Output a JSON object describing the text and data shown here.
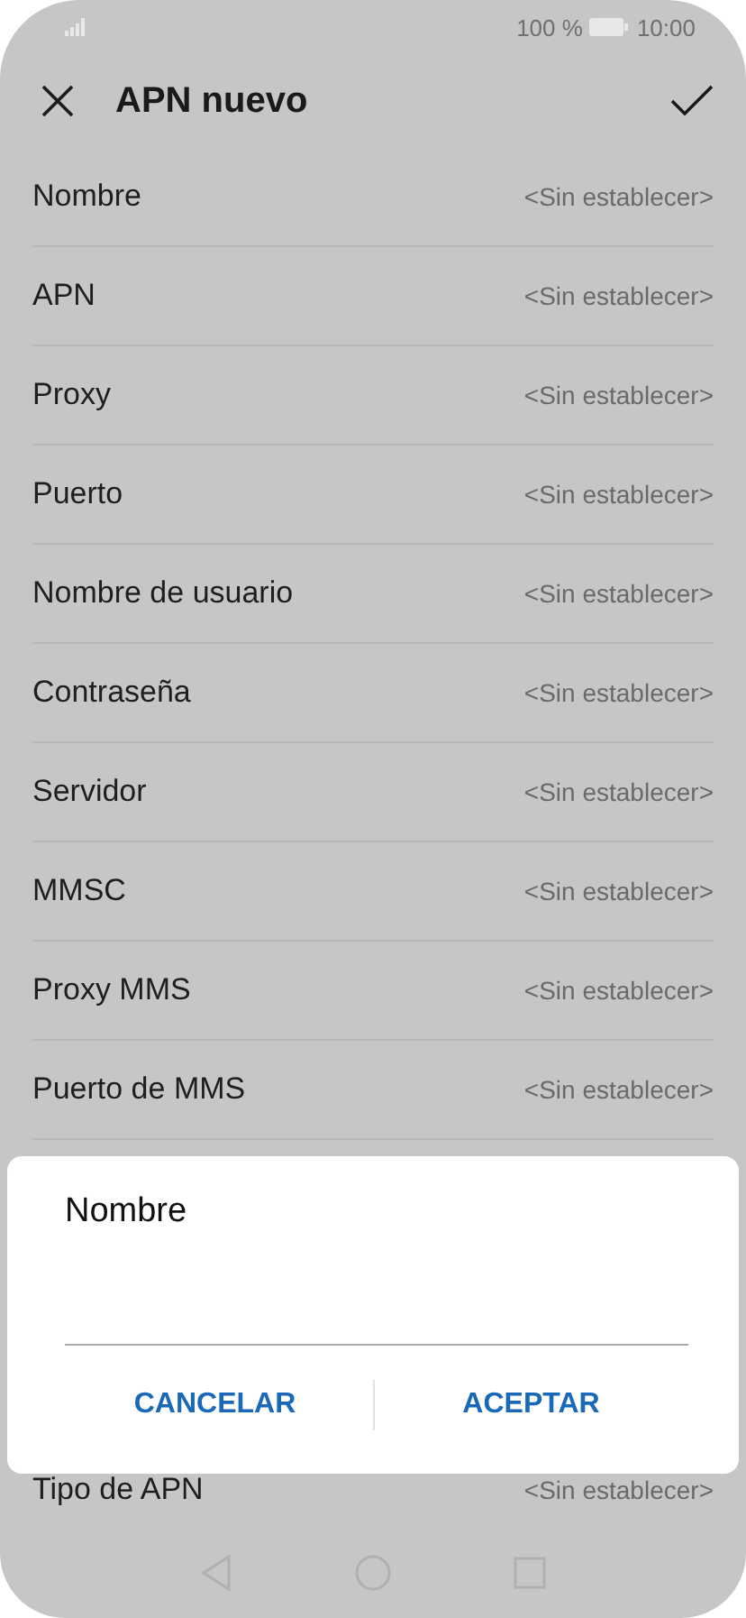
{
  "status_bar": {
    "battery": "100 %",
    "time": "10:00"
  },
  "header": {
    "title": "APN nuevo"
  },
  "rows": [
    {
      "label": "Nombre",
      "value": "<Sin establecer>"
    },
    {
      "label": "APN",
      "value": "<Sin establecer>"
    },
    {
      "label": "Proxy",
      "value": "<Sin establecer>"
    },
    {
      "label": "Puerto",
      "value": "<Sin establecer>"
    },
    {
      "label": "Nombre de usuario",
      "value": "<Sin establecer>"
    },
    {
      "label": "Contraseña",
      "value": "<Sin establecer>"
    },
    {
      "label": "Servidor",
      "value": "<Sin establecer>"
    },
    {
      "label": "MMSC",
      "value": "<Sin establecer>"
    },
    {
      "label": "Proxy MMS",
      "value": "<Sin establecer>"
    },
    {
      "label": "Puerto de MMS",
      "value": "<Sin establecer>"
    }
  ],
  "last_row": {
    "label": "Tipo de APN",
    "value": "<Sin establecer>"
  },
  "dialog": {
    "title": "Nombre",
    "buttons": [
      "CANCELAR",
      "ACEPTAR"
    ]
  }
}
